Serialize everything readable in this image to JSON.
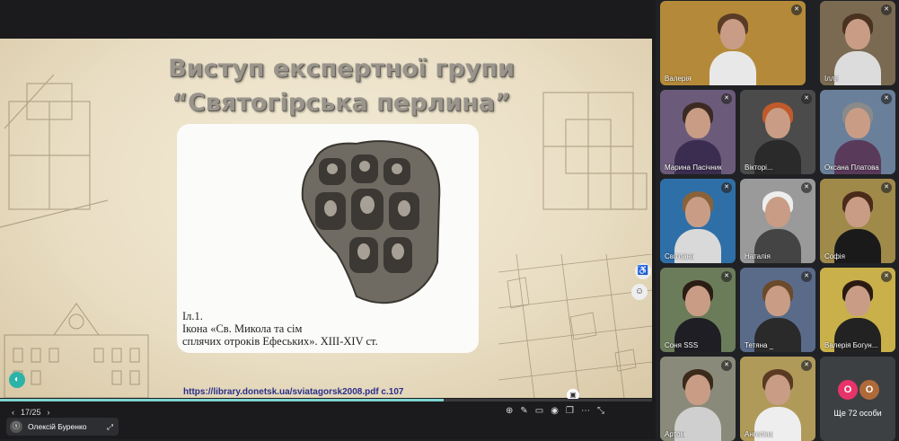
{
  "slide": {
    "title_line1": "Виступ експертної групи",
    "title_line2": "“Святогірська перлина”",
    "caption_line1": "Іл.1.",
    "caption_line2": "Ікона «Св. Микола та сім",
    "caption_line3": "сплячих отроків Ефеських». XIII-XIV ст.",
    "source": "https://library.donetsk.ua/sviatagorsk2008.pdf  с.107",
    "page_indicator": "17/25",
    "progress": 0.68
  },
  "presenter": {
    "name": "Олексій Буренко"
  },
  "participants": [
    {
      "name": "Валерія",
      "bg": "#b48a3a",
      "shirt": "#e8e8e8",
      "hair": "#5a3b25"
    },
    {
      "name": "Ілля",
      "bg": "#7b6a52",
      "shirt": "#dcdcdc",
      "hair": "#4a3220"
    },
    {
      "name": "Марина Пасічник",
      "bg": "#6b5a7a",
      "shirt": "#3a2d50",
      "hair": "#3b2a22"
    },
    {
      "name": "Вікторі...",
      "bg": "#4b4b4b",
      "shirt": "#2a2a2a",
      "hair": "#c05a2a"
    },
    {
      "name": "Оксана Платова",
      "bg": "#6a7f9a",
      "shirt": "#5a3a5a",
      "hair": "#8a8a8a"
    },
    {
      "name": "Світлана",
      "bg": "#2f6fa8",
      "shirt": "#d9d9d9",
      "hair": "#8a6238"
    },
    {
      "name": "Наталія",
      "bg": "#9a9a9a",
      "shirt": "#444",
      "hair": "#eeeeee"
    },
    {
      "name": "Софія",
      "bg": "#a08a4a",
      "shirt": "#1a1a1a",
      "hair": "#4a2a1a"
    },
    {
      "name": "Соня SSS",
      "bg": "#6b7c5a",
      "shirt": "#1e1e24",
      "hair": "#2a1d15"
    },
    {
      "name": "Тетяна _",
      "bg": "#5a6b8a",
      "shirt": "#2a2a2a",
      "hair": "#6a4a2a"
    },
    {
      "name": "Валерія Богун...",
      "bg": "#c9b04a",
      "shirt": "#222",
      "hair": "#2a1a12"
    },
    {
      "name": "Артом",
      "bg": "#8a8a7a",
      "shirt": "#cfcfcf",
      "hair": "#3a2a1a"
    },
    {
      "name": "Ангеліна",
      "bg": "#b09a5a",
      "shirt": "#eeeeee",
      "hair": "#5a3a22"
    }
  ],
  "more": {
    "label": "Ще 72 особи",
    "dot1": "O",
    "dot2": "O",
    "dot1_color": "#e8336a",
    "dot2_color": "#b06a3a"
  },
  "icons": [
    "zoom-icon",
    "pen-icon",
    "captions-icon",
    "copy-icon",
    "screen-icon",
    "more-icon",
    "expand-icon"
  ]
}
